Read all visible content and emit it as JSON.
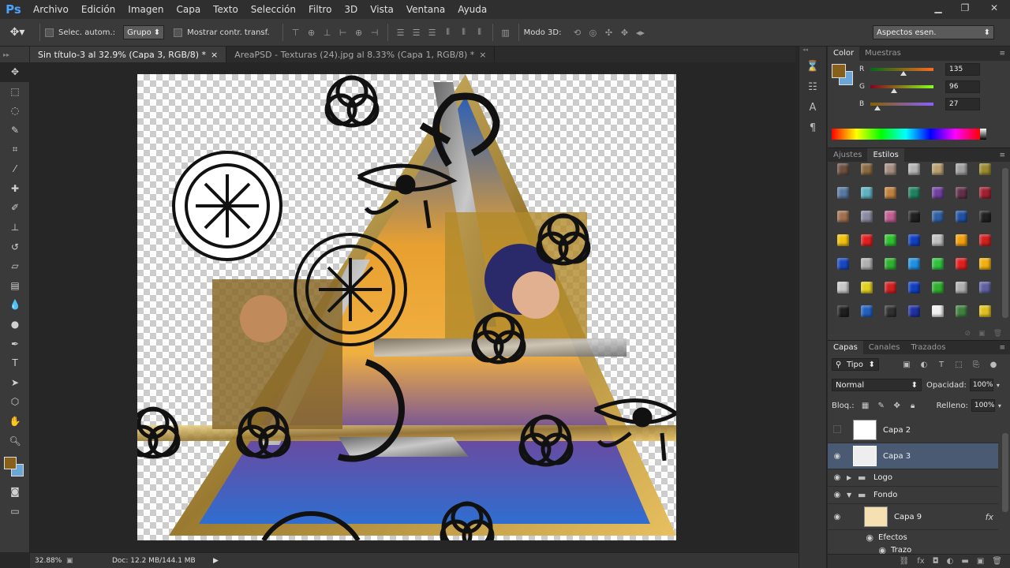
{
  "app": {
    "logo": "Ps"
  },
  "menu": [
    "Archivo",
    "Edición",
    "Imagen",
    "Capa",
    "Texto",
    "Selección",
    "Filtro",
    "3D",
    "Vista",
    "Ventana",
    "Ayuda"
  ],
  "options": {
    "auto_select_label": "Selec. autom.:",
    "auto_select_value": "Grupo",
    "show_transform_label": "Mostrar contr. transf.",
    "mode3d_label": "Modo 3D:",
    "workspace": "Aspectos esen."
  },
  "tabs": [
    {
      "label": "Sin título-3 al 32.9% (Capa 3, RGB/8) *",
      "close": "×",
      "active": true
    },
    {
      "label": "AreaPSD - Texturas (24).jpg al 8.33% (Capa 1, RGB/8) *",
      "close": "×",
      "active": false
    }
  ],
  "status": {
    "zoom": "32.88%",
    "doc": "Doc: 12.2 MB/144.1 MB",
    "arrow": "▶"
  },
  "colors": {
    "foreground": "#87601b",
    "background": "#6aa6d8",
    "accent": "#4aa3ff",
    "selected_row": "#4a5a73"
  },
  "color_panel": {
    "tabs": [
      "Color",
      "Muestras"
    ],
    "r_label": "R",
    "g_label": "G",
    "b_label": "B",
    "r": "135",
    "g": "96",
    "b": "27",
    "r_fraction": 0.53,
    "g_fraction": 0.38,
    "b_fraction": 0.11
  },
  "styles_panel": {
    "tabs": [
      "Ajustes",
      "Estilos"
    ],
    "swatch_colors": [
      "#6a5040",
      "#8a6a40",
      "#a48f82",
      "#b2b2b2",
      "#b8a070",
      "#a0a0a0",
      "#9a8a30",
      "#5878a0",
      "#5fb0c0",
      "#c08040",
      "#208060",
      "#7040a0",
      "#603048",
      "#a02030",
      "#a07050",
      "#8a8aa0",
      "#c06090",
      "#202020",
      "#3060a0",
      "#2050a0",
      "#202020",
      "#f0c010",
      "#e02020",
      "#30c030",
      "#1040c0",
      "#c0c0c0",
      "#f0a010",
      "#d02020",
      "#1848c0",
      "#b0b0b0",
      "#30b030",
      "#2090e0",
      "#30c040",
      "#e02020",
      "#f0b010",
      "#c8c8c8",
      "#e0d020",
      "#d02020",
      "#1040c0",
      "#30b030",
      "#b0b0b0",
      "#6060a0",
      "#202020",
      "#2060c0",
      "#303030",
      "#2030a0",
      "#f0f0f0",
      "#408040",
      "#e0c020",
      "#e0c060",
      "#f0f0d0",
      "#20c0c0",
      "#c08020",
      "#e0c0a0",
      "#c06020",
      "#e0a080"
    ]
  },
  "layers_panel": {
    "tabs": [
      "Capas",
      "Canales",
      "Trazados"
    ],
    "filter": "Tipo",
    "blend_mode": "Normal",
    "opacity_label": "Opacidad:",
    "opacity": "100%",
    "lock_label": "Bloq.:",
    "fill_label": "Relleno:",
    "fill": "100%",
    "layers": [
      {
        "name": "Capa 2",
        "visible": false,
        "selected": false
      },
      {
        "name": "Capa 3",
        "visible": true,
        "selected": true
      }
    ],
    "groups": [
      "Logo",
      "Fondo"
    ],
    "sublayer": {
      "name": "Capa 9",
      "fx": "fx"
    },
    "effects_label": "Efectos",
    "trazo_label": "Trazo"
  }
}
